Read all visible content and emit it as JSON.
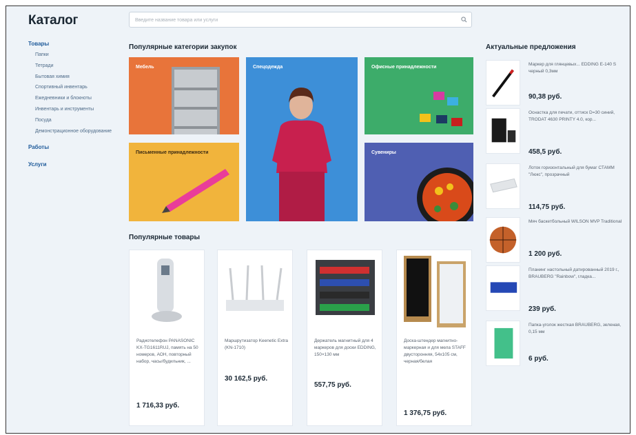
{
  "header": {
    "logo": "Каталог",
    "search_placeholder": "Введите название товара или услуги"
  },
  "sidebar": {
    "goods_label": "Товары",
    "items": [
      {
        "label": "Папки"
      },
      {
        "label": "Тетради"
      },
      {
        "label": "Бытовая химия"
      },
      {
        "label": "Спортивный инвентарь"
      },
      {
        "label": "Ежедневники и блокноты"
      },
      {
        "label": "Инвентарь и инструменты"
      },
      {
        "label": "Посуда"
      },
      {
        "label": "Демонстрационное оборудование"
      }
    ],
    "works_label": "Работы",
    "services_label": "Услуги"
  },
  "categories": {
    "title": "Популярные категории закупок",
    "tiles": [
      {
        "label": "Мебель",
        "color": "#e8743a"
      },
      {
        "label": "Спецодежда",
        "color": "#3d8fd8"
      },
      {
        "label": "Офисные принадлежности",
        "color": "#3dac6a"
      },
      {
        "label": "Письменные принадлежности",
        "color": "#f1b43c"
      },
      {
        "label": "Сувениры",
        "color": "#4f5fb2"
      }
    ]
  },
  "products": {
    "title": "Популярные товары",
    "items": [
      {
        "title": "Радиотелефон PANASONIC KX-TG1611RUJ, память на 50 номеров, АОН, повторный набор, часы/будильник, ...",
        "price": "1 716,33 руб."
      },
      {
        "title": "Маршрутизатор Keenetic Extra (KN-1710)",
        "price": "30 162,5 руб."
      },
      {
        "title": "Держатель магнитный для 4 маркеров для доски EDDING, 150×130 мм",
        "price": "557,75 руб."
      },
      {
        "title": "Доска-штендер магнитно-маркерная и для мела STAFF двусторонняя, 54х105 см, черная/белая",
        "price": "1 376,75 руб."
      }
    ]
  },
  "offers": {
    "title": "Актуальные предложения",
    "items": [
      {
        "title": "Маркер для глянцевых... EDDING E-140 S черный 0,3мм",
        "price": "90,38 руб."
      },
      {
        "title": "Оснастка для печати, оттиск D=30 синий, TRODAT 4630 PRINTY 4.0, кор...",
        "price": "458,5 руб."
      },
      {
        "title": "Лоток горизонтальный для бумаг СТАММ \"Люкс\", прозрачный",
        "price": "114,75 руб."
      },
      {
        "title": "Мяч баскетбольный WILSON MVP Traditional",
        "price": "1 200 руб."
      },
      {
        "title": "Планинг настольный датированный 2019 г., BRAUBERG \"Rainbow\", гладка...",
        "price": "239 руб."
      },
      {
        "title": "Папка-уголок жесткая BRAUBERG, зеленая, 0,15 мм",
        "price": "6 руб."
      }
    ]
  }
}
